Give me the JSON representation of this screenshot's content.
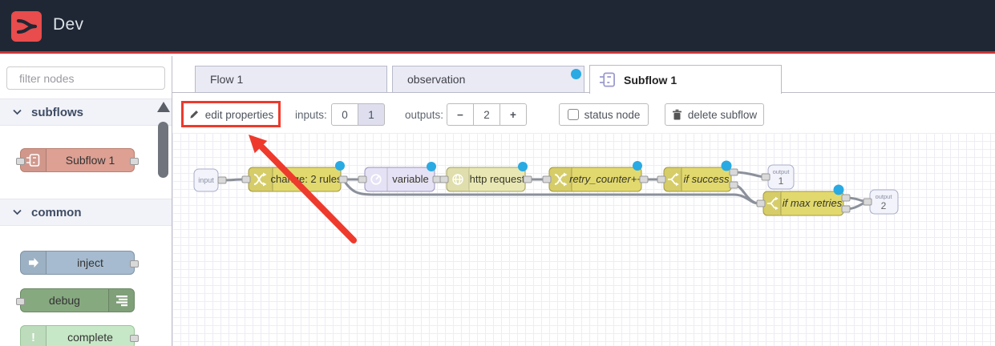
{
  "header": {
    "title": "Dev"
  },
  "sidebar": {
    "search": {
      "placeholder": "filter nodes"
    },
    "sections": [
      {
        "label": "subflows",
        "items": [
          {
            "label": "Subflow 1"
          }
        ]
      },
      {
        "label": "common",
        "items": [
          {
            "label": "inject"
          },
          {
            "label": "debug"
          },
          {
            "label": "complete"
          }
        ]
      }
    ]
  },
  "tabs": [
    {
      "label": "Flow 1",
      "active": false,
      "modified": false
    },
    {
      "label": "observation",
      "active": false,
      "modified": true
    },
    {
      "label": "Subflow 1",
      "active": true,
      "modified": false
    }
  ],
  "toolbar": {
    "edit_button": "edit properties",
    "inputs_label": "inputs:",
    "inputs_options": [
      "0",
      "1"
    ],
    "inputs_selected": "1",
    "outputs_label": "outputs:",
    "outputs_minus": "−",
    "outputs_value": "2",
    "outputs_plus": "+",
    "status_button": "status node",
    "delete_button": "delete subflow"
  },
  "canvas": {
    "nodes": {
      "input": "input",
      "change": "change: 2 rules",
      "variable": "variable",
      "http": "http request",
      "retry": "retry_counter++",
      "if_success": "if success",
      "if_max": "if max retries",
      "output_caption": "output",
      "output1": "1",
      "output2": "2"
    }
  },
  "colors": {
    "header_bg": "#202734",
    "header_rule": "#c93636",
    "logo_red": "#e84c4c",
    "modified_dot": "#29aae3",
    "annotation_red": "#ee3a2c",
    "node_yellow": "#e2d96e",
    "node_lavender": "#e6e2f5",
    "node_khaki": "#e9e8b4",
    "node_salmon": "#dda093",
    "node_inject_blue": "#a6bbcf",
    "node_debug_green": "#87a980",
    "node_complete_green": "#c7e8c7",
    "wire_gray": "#8b909a"
  }
}
